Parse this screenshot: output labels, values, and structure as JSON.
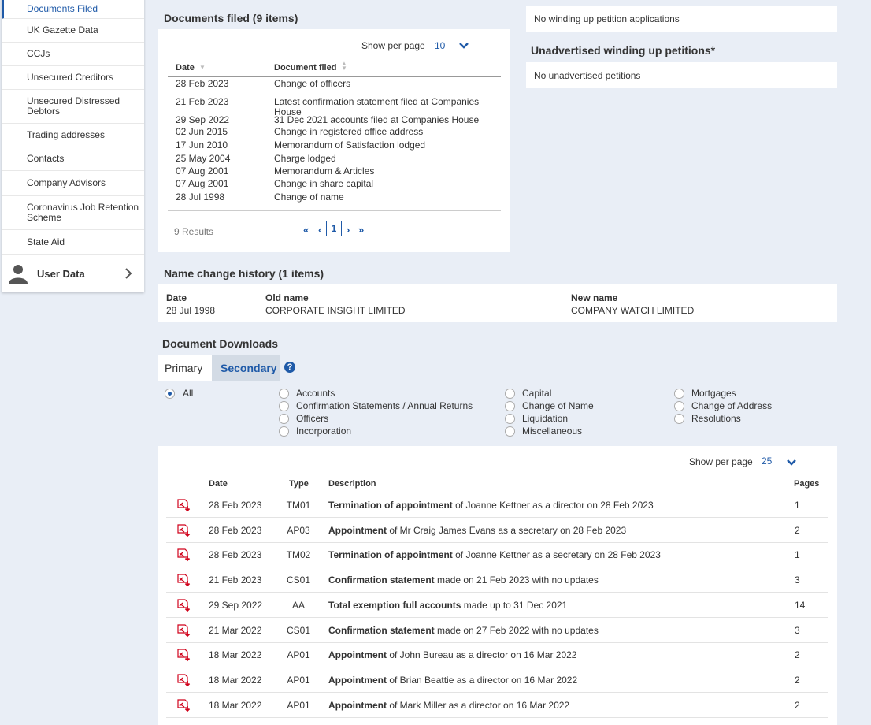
{
  "sidebar": {
    "items": [
      "Documents Filed",
      "UK Gazette Data",
      "CCJs",
      "Unsecured Creditors",
      "Unsecured Distressed Debtors",
      "Trading addresses",
      "Contacts",
      "Company Advisors",
      "Coronavirus Job Retention Scheme",
      "State Aid"
    ],
    "user_data": "User Data"
  },
  "docs_filed": {
    "title": "Documents filed (9 items)",
    "show_per_page_label": "Show per page",
    "show_per_page_value": "10",
    "col_date": "Date",
    "col_doc": "Document filed",
    "rows": [
      [
        "28 Feb 2023",
        "Change of officers"
      ],
      [
        "21 Feb 2023",
        "Latest confirmation statement filed at Companies House"
      ],
      [
        "29 Sep 2022",
        "31 Dec 2021 accounts filed at Companies House"
      ],
      [
        "02 Jun 2015",
        "Change in registered office address"
      ],
      [
        "17 Jun 2010",
        "Memorandum of Satisfaction lodged"
      ],
      [
        "25 May 2004",
        "Charge lodged"
      ],
      [
        "07 Aug 2001",
        "Memorandum & Articles"
      ],
      [
        "07 Aug 2001",
        "Change in share capital"
      ],
      [
        "28 Jul 1998",
        "Change of name"
      ]
    ],
    "results": "9 Results",
    "pager": {
      "first": "«",
      "prev": "‹",
      "page": "1",
      "next": "›",
      "last": "»"
    }
  },
  "winding": {
    "top_text": "No winding up petition applications",
    "title": "Unadvertised winding up petitions*",
    "text": "No unadvertised petitions"
  },
  "name_change": {
    "title": "Name change history (1 items)",
    "col_date": "Date",
    "col_old": "Old name",
    "col_new": "New name",
    "date": "28 Jul 1998",
    "old": "CORPORATE INSIGHT LIMITED",
    "new": "COMPANY WATCH LIMITED"
  },
  "downloads": {
    "title": "Document Downloads",
    "tab_primary": "Primary",
    "tab_secondary": "Secondary",
    "help": "?",
    "filters": [
      [
        "All"
      ],
      [
        "Accounts",
        "Confirmation Statements / Annual Returns",
        "Officers",
        "Incorporation"
      ],
      [
        "Capital",
        "Change of Name",
        "Liquidation",
        "Miscellaneous"
      ],
      [
        "Mortgages",
        "Change of Address",
        "Resolutions"
      ]
    ],
    "show_per_page_label": "Show per page",
    "show_per_page_value": "25",
    "col_date": "Date",
    "col_type": "Type",
    "col_desc": "Description",
    "col_pages": "Pages",
    "rows": [
      [
        "28 Feb 2023",
        "TM01",
        "Termination of appointment",
        " of Joanne Kettner as a director on 28 Feb 2023",
        "1"
      ],
      [
        "28 Feb 2023",
        "AP03",
        "Appointment",
        " of Mr Craig James Evans as a secretary on 28 Feb 2023",
        "2"
      ],
      [
        "28 Feb 2023",
        "TM02",
        "Termination of appointment",
        " of Joanne Kettner as a secretary on 28 Feb 2023",
        "1"
      ],
      [
        "21 Feb 2023",
        "CS01",
        "Confirmation statement",
        " made on 21 Feb 2023 with no updates",
        "3"
      ],
      [
        "29 Sep 2022",
        "AA",
        "Total exemption full accounts",
        " made up to 31 Dec 2021",
        "14"
      ],
      [
        "21 Mar 2022",
        "CS01",
        "Confirmation statement",
        " made on 27 Feb 2022 with no updates",
        "3"
      ],
      [
        "18 Mar 2022",
        "AP01",
        "Appointment",
        " of John Bureau as a director on 16 Mar 2022",
        "2"
      ],
      [
        "18 Mar 2022",
        "AP01",
        "Appointment",
        " of Brian Beattie as a director on 16 Mar 2022",
        "2"
      ],
      [
        "18 Mar 2022",
        "AP01",
        "Appointment",
        " of Mark Miller as a director on 16 Mar 2022",
        "2"
      ]
    ]
  }
}
